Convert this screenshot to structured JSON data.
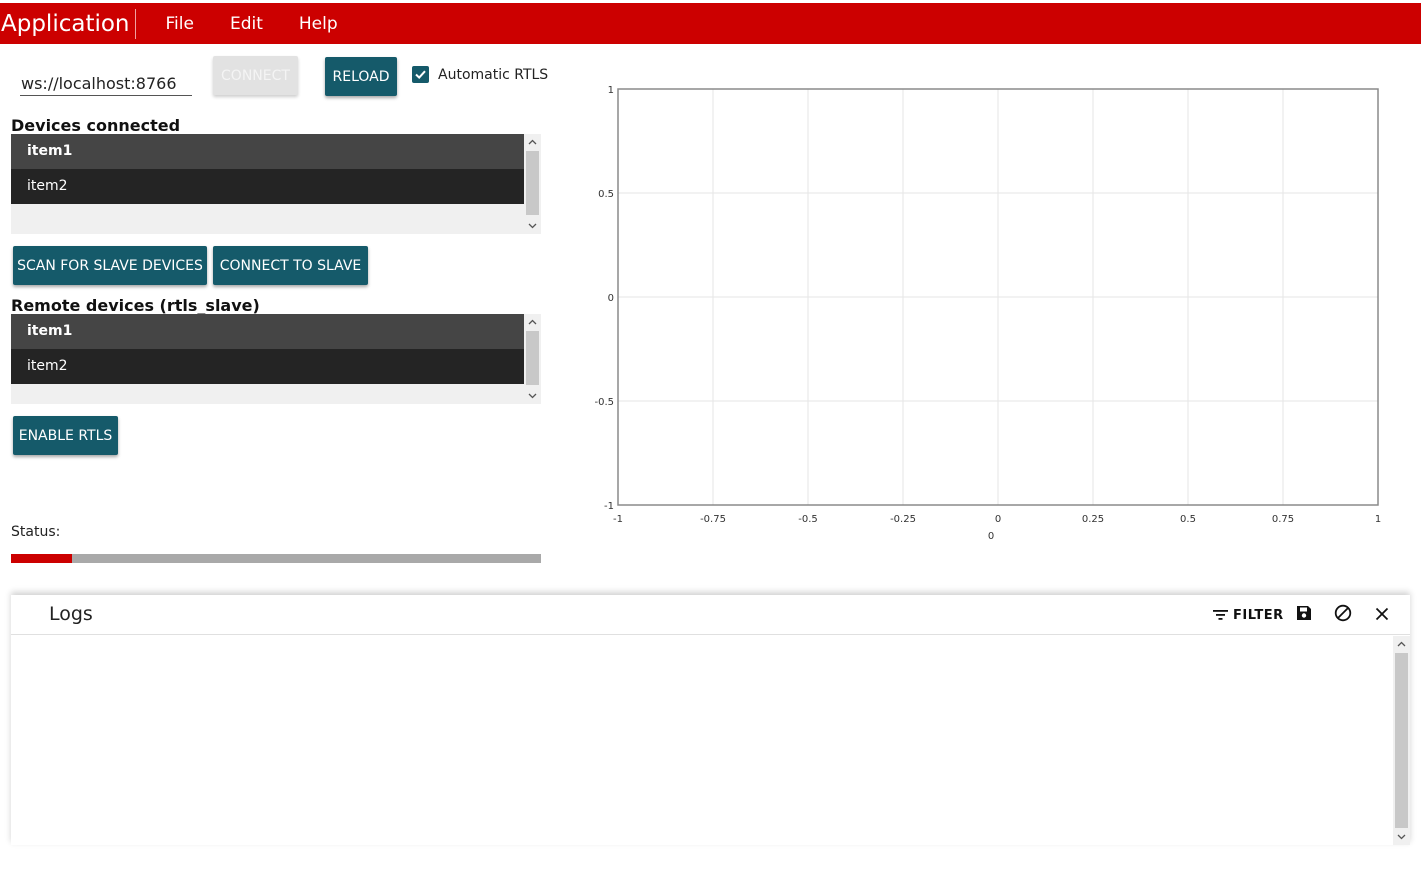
{
  "menubar": {
    "app_title": "Application",
    "items": [
      "File",
      "Edit",
      "Help"
    ],
    "color": "#cc0000"
  },
  "controls": {
    "ws_url": "ws://localhost:8766",
    "connect_label": "CONNECT",
    "reload_label": "RELOAD",
    "auto_rtls_label": "Automatic RTLS",
    "auto_rtls_checked": true,
    "accent": "#155a6a"
  },
  "devices": {
    "title": "Devices connected",
    "items": [
      "item1",
      "item2"
    ],
    "selected_index": 0,
    "scan_label": "SCAN FOR SLAVE DEVICES",
    "connect_slave_label": "CONNECT TO SLAVE"
  },
  "remote": {
    "title": "Remote devices (rtls_slave)",
    "items": [
      "item1",
      "item2"
    ],
    "selected_index": 0,
    "enable_label": "ENABLE RTLS"
  },
  "status": {
    "label": "Status:",
    "progress": 0.115
  },
  "chart_data": {
    "type": "scatter",
    "x_ticks": [
      "-1",
      "-0.75",
      "-0.5",
      "-0.25",
      "0",
      "0.25",
      "0.5",
      "0.75",
      "1"
    ],
    "y_ticks": [
      "1",
      "0.5",
      "0",
      "-0.5",
      "-1"
    ],
    "xlim": [
      -1,
      1
    ],
    "ylim": [
      -1,
      1
    ],
    "xlabel": "0",
    "series": [],
    "grid": true
  },
  "logs": {
    "title": "Logs",
    "filter_label": "FILTER",
    "icons": [
      "filter-icon",
      "save-icon",
      "clear-icon",
      "close-icon"
    ]
  }
}
